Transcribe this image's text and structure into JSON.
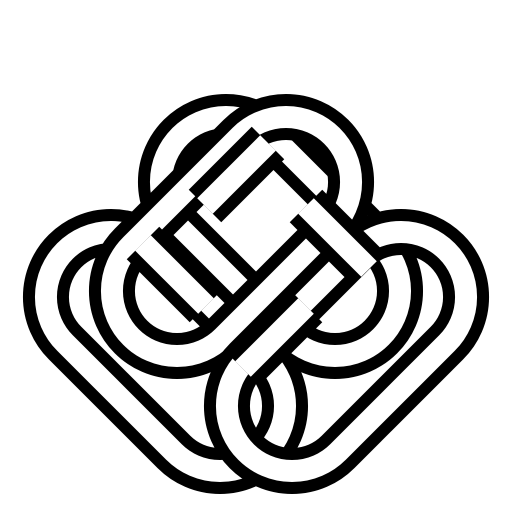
{
  "logo": {
    "name": "interlaced-knot-logo-icon",
    "colors": {
      "background": "#ffffff",
      "ink": "#000000",
      "fill": "#ffffff"
    }
  }
}
